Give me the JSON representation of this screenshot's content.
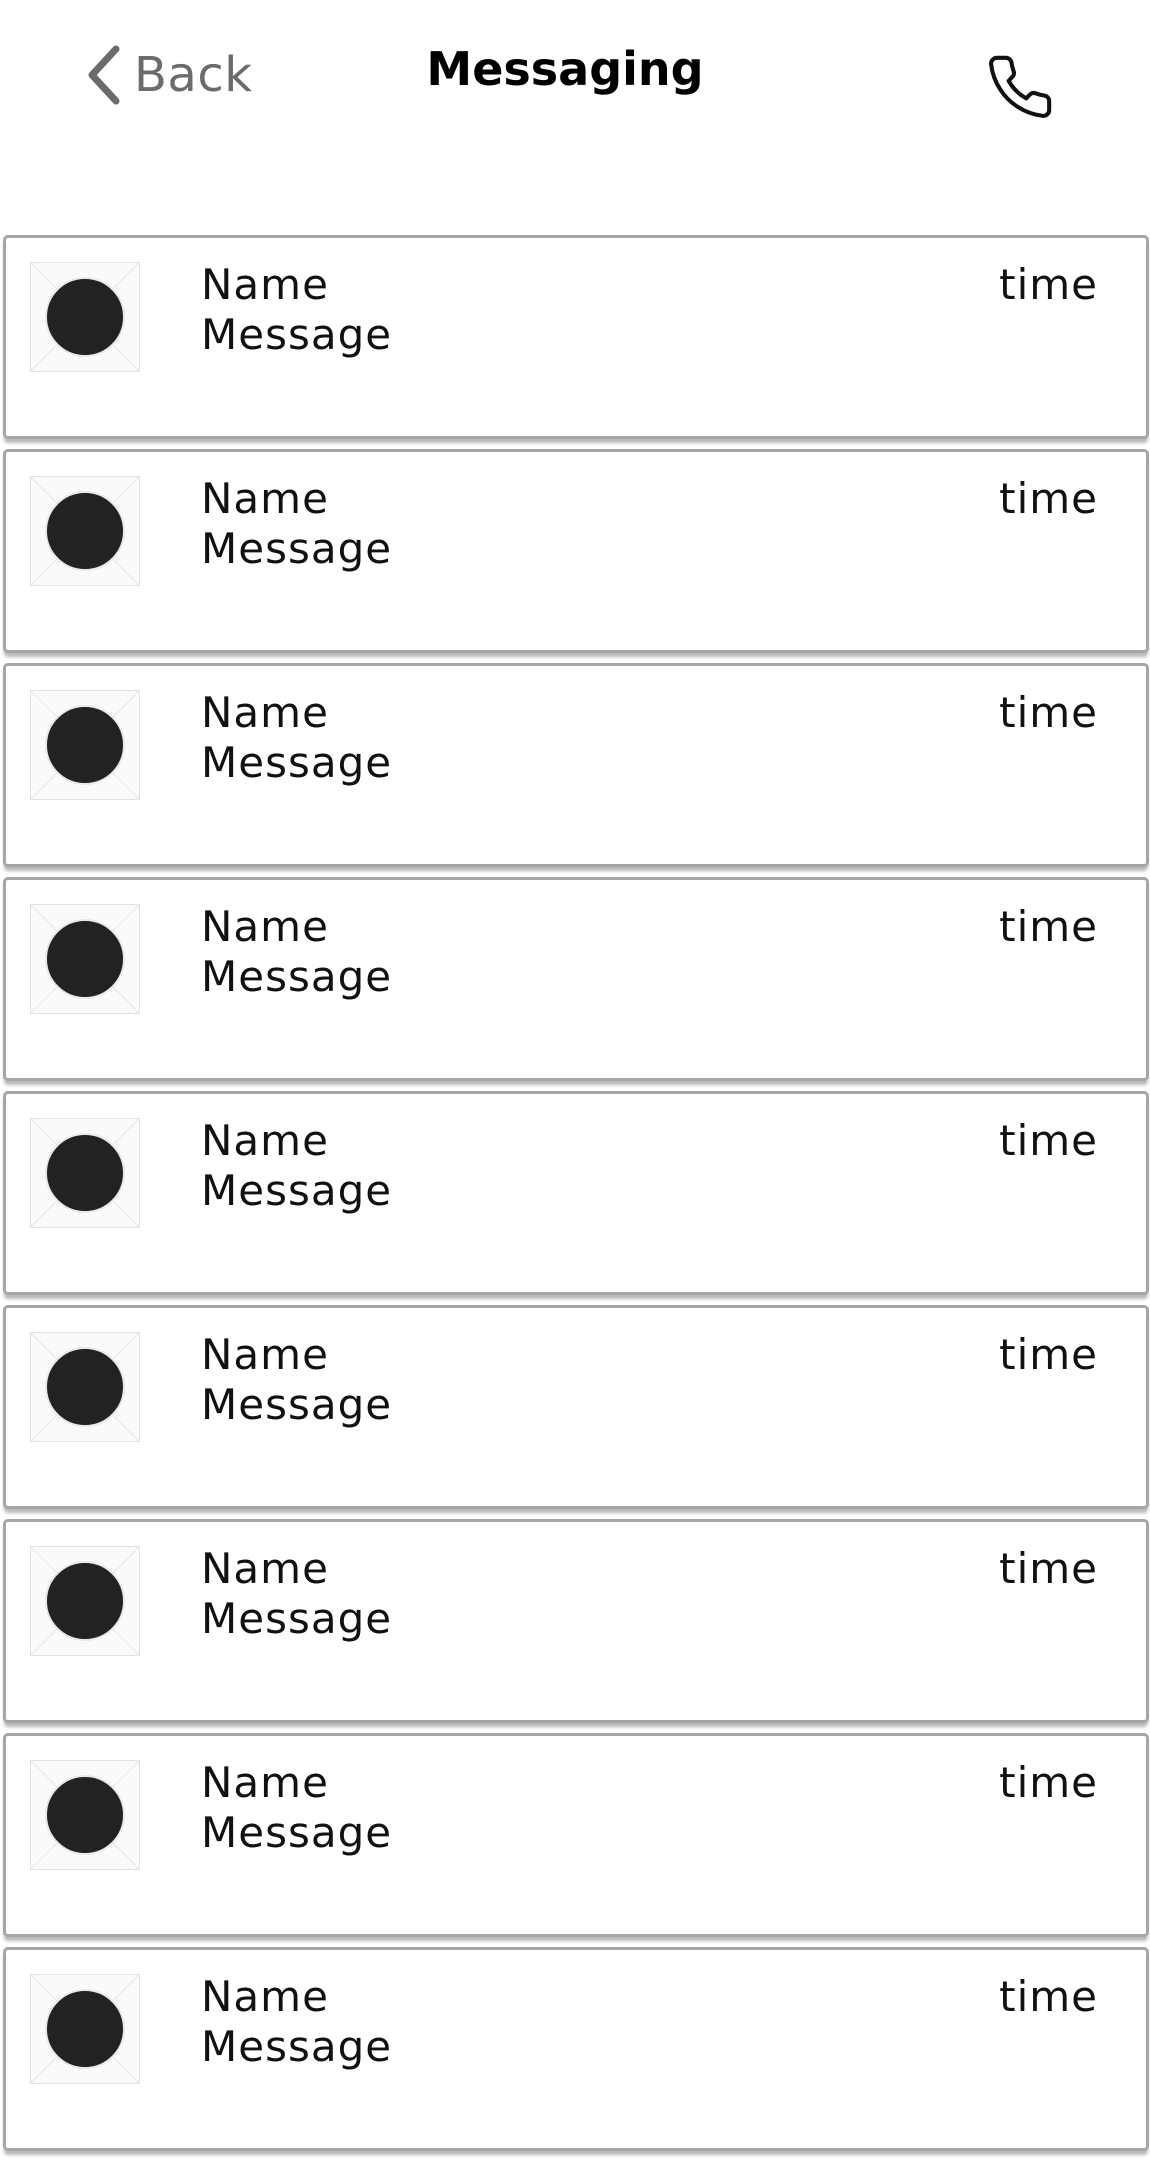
{
  "header": {
    "back_label": "Back",
    "title": "Messaging",
    "back_icon": "chevron-left-icon",
    "call_icon": "phone-icon"
  },
  "conversations": [
    {
      "name": "Name",
      "message": "Message",
      "time": "time"
    },
    {
      "name": "Name",
      "message": "Message",
      "time": "time"
    },
    {
      "name": "Name",
      "message": "Message",
      "time": "time"
    },
    {
      "name": "Name",
      "message": "Message",
      "time": "time"
    },
    {
      "name": "Name",
      "message": "Message",
      "time": "time"
    },
    {
      "name": "Name",
      "message": "Message",
      "time": "time"
    },
    {
      "name": "Name",
      "message": "Message",
      "time": "time"
    },
    {
      "name": "Name",
      "message": "Message",
      "time": "time"
    },
    {
      "name": "Name",
      "message": "Message",
      "time": "time"
    }
  ],
  "colors": {
    "text": "#111111",
    "back": "#6b6b6b",
    "border": "#a6a6a6",
    "avatar": "#222222"
  }
}
